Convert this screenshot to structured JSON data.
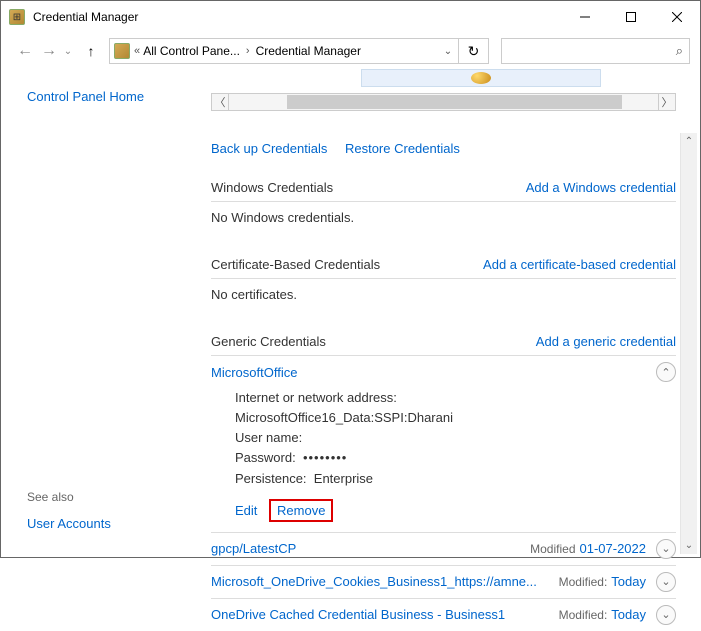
{
  "window": {
    "title": "Credential Manager"
  },
  "nav": {
    "breadcrumb1": "All Control Pane...",
    "breadcrumb2": "Credential Manager"
  },
  "left": {
    "home": "Control Panel Home",
    "seealso": "See also",
    "useraccounts": "User Accounts"
  },
  "toplinks": {
    "backup": "Back up Credentials",
    "restore": "Restore Credentials"
  },
  "sections": {
    "windows": {
      "title": "Windows Credentials",
      "add": "Add a Windows credential",
      "empty": "No Windows credentials."
    },
    "cert": {
      "title": "Certificate-Based Credentials",
      "add": "Add a certificate-based credential",
      "empty": "No certificates."
    },
    "generic": {
      "title": "Generic Credentials",
      "add": "Add a generic credential"
    }
  },
  "expanded": {
    "name": "MicrosoftOffice",
    "addr_label": "Internet or network address:",
    "addr_value": "MicrosoftOffice16_Data:SSPI:Dharani",
    "user_label": "User name:",
    "pass_label": "Password:",
    "pass_value": "••••••••",
    "persist_label": "Persistence:",
    "persist_value": "Enterprise",
    "edit": "Edit",
    "remove": "Remove"
  },
  "collapsed": [
    {
      "name": "gpcp/LatestCP",
      "mod_label": "Modified",
      "mod_value": "01-07-2022"
    },
    {
      "name": "Microsoft_OneDrive_Cookies_Business1_https://amne...",
      "mod_label": "Modified:",
      "mod_value": "Today"
    },
    {
      "name": "OneDrive Cached Credential Business - Business1",
      "mod_label": "Modified:",
      "mod_value": "Today"
    }
  ]
}
